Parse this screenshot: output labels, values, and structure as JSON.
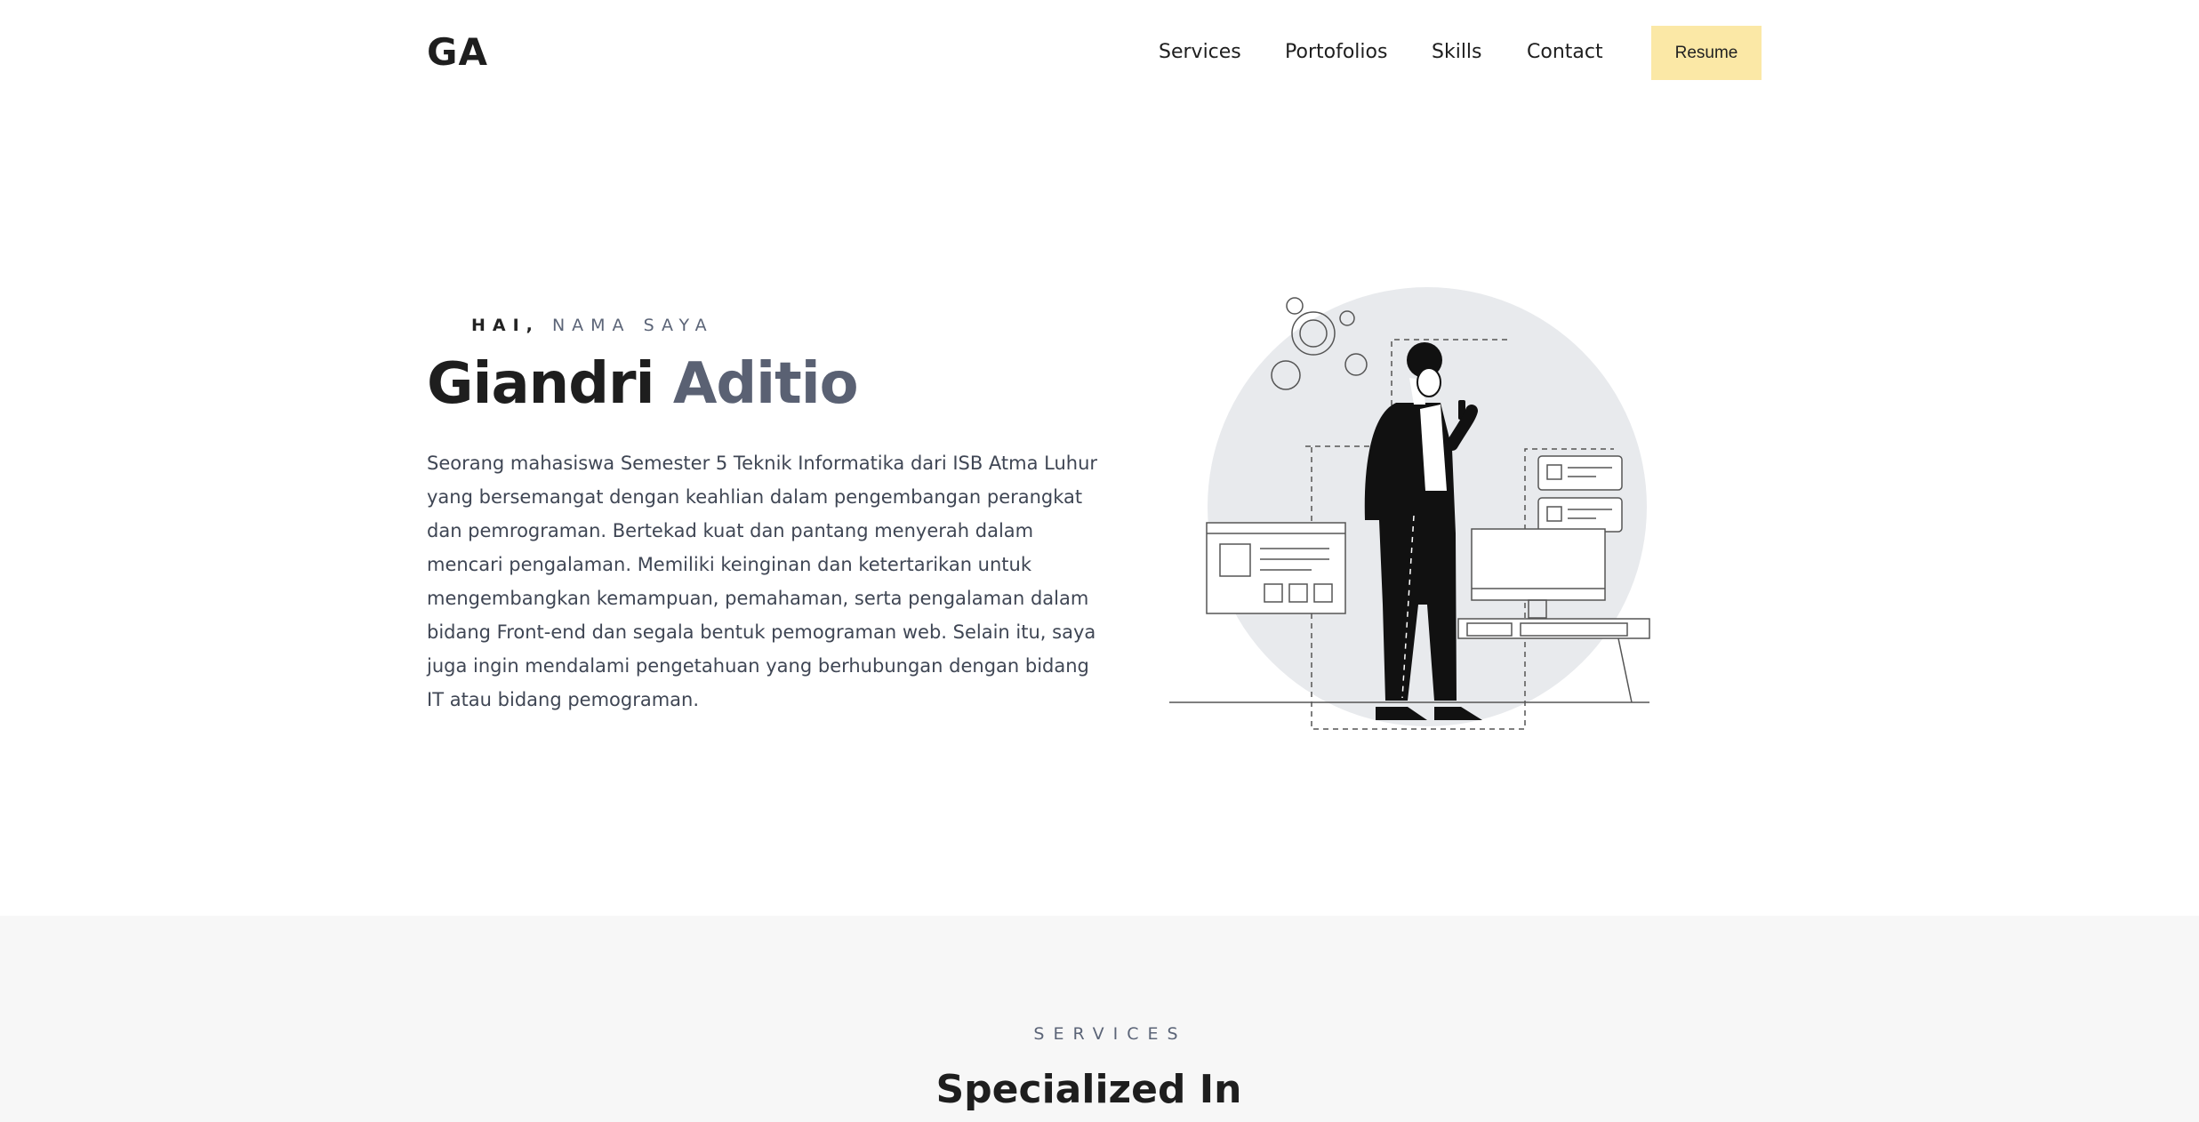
{
  "header": {
    "logo": "GA",
    "nav": [
      "Services",
      "Portofolios",
      "Skills",
      "Contact"
    ],
    "resume_label": "Resume",
    "resume_bg": "#fbe8a6"
  },
  "hero": {
    "greeting_bold": "HAI,",
    "greeting_rest": "NAMA SAYA",
    "name_first": "Giandri",
    "name_last": "Aditio",
    "description": "Seorang mahasiswa Semester 5 Teknik Informatika dari ISB Atma Luhur yang bersemangat dengan keahlian dalam pengembangan perangkat dan pemrograman. Bertekad kuat dan pantang menyerah dalam mencari pengalaman. Memiliki keinginan dan ketertarikan untuk mengembangkan kemampuan, pemahaman, serta pengalaman dalam bidang Front-end dan segala bentuk pemograman web. Selain itu, saya juga ingin mendalami pengetahuan yang berhubungan dengan bidang IT atau bidang pemograman.",
    "illustration_icon": "developer-illustration"
  },
  "services": {
    "label": "SERVICES",
    "title": "Specialized In"
  },
  "colors": {
    "text_dark": "#1e1e1e",
    "text_muted": "#5a6173",
    "section_bg": "#f7f7f7",
    "circle_bg": "#e8eaed"
  }
}
